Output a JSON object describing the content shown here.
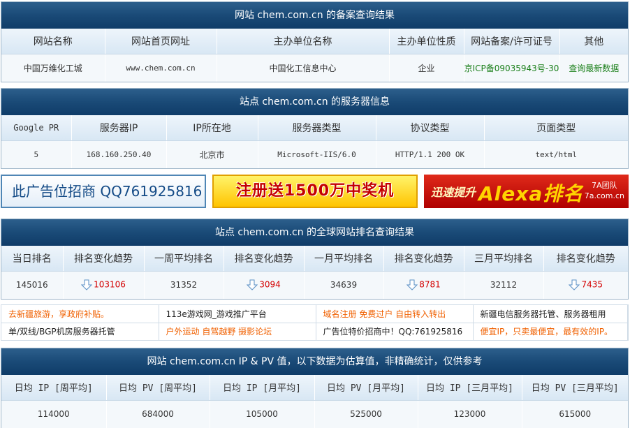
{
  "icp": {
    "title": "网站 chem.com.cn 的备案查询结果",
    "headers": [
      "网站名称",
      "网站首页网址",
      "主办单位名称",
      "主办单位性质",
      "网站备案/许可证号",
      "其他"
    ],
    "row": [
      "中国万维化工城",
      "www.chem.com.cn",
      "中国化工信息中心",
      "企业",
      "京ICP备09035943号-30",
      "查询最新数据"
    ]
  },
  "server": {
    "title": "站点 chem.com.cn 的服务器信息",
    "headers": [
      "Google PR",
      "服务器IP",
      "IP所在地",
      "服务器类型",
      "协议类型",
      "页面类型"
    ],
    "row": [
      "5",
      "168.160.250.40",
      "北京市",
      "Microsoft-IIS/6.0",
      "HTTP/1.1 200 OK",
      "text/html"
    ]
  },
  "ads": {
    "ad1": "此广告位招商 QQ761925816",
    "ad2": "注册送1500万中奖机",
    "ad3_small": "迅速提升",
    "ad3_big": "Alexa排名",
    "ad3_team": "7A团队",
    "ad3_site": "7a.com.cn"
  },
  "rank": {
    "title": "站点 chem.com.cn 的全球网站排名查询结果",
    "headers": [
      "当日排名",
      "排名变化趋势",
      "一周平均排名",
      "排名变化趋势",
      "一月平均排名",
      "排名变化趋势",
      "三月平均排名",
      "排名变化趋势"
    ],
    "row": [
      "145016",
      "103106",
      "31352",
      "3094",
      "34639",
      "8781",
      "32112",
      "7435"
    ]
  },
  "links": {
    "row1": [
      "去新疆旅游，享政府补贴。",
      "113e游戏网_游戏推广平台",
      "域名注册 免费过户 自由转入转出",
      "新疆电信服务器托管、服务器租用"
    ],
    "row2": [
      "单/双线/BGP机房服务器托管",
      "户外运动 自驾越野 摄影论坛",
      "广告位特价招商中！QQ:761925816",
      "便宜IP，只卖最便宜，最有效的IP。"
    ]
  },
  "pv": {
    "title": "网站 chem.com.cn IP & PV 值，以下数据为估算值，非精确统计，仅供参考",
    "headers": [
      "日均 IP [周平均]",
      "日均 PV [周平均]",
      "日均 IP [月平均]",
      "日均 PV [月平均]",
      "日均 IP [三月平均]",
      "日均 PV [三月平均]"
    ],
    "row": [
      "114000",
      "684000",
      "105000",
      "525000",
      "123000",
      "615000"
    ]
  },
  "colors": {
    "header_blue": "#1a4a77",
    "trend_red": "#d40000",
    "icp_green": "#1a7f1a",
    "link_orange": "#f06000"
  },
  "icons": {
    "trend": "arrow-down-icon"
  }
}
